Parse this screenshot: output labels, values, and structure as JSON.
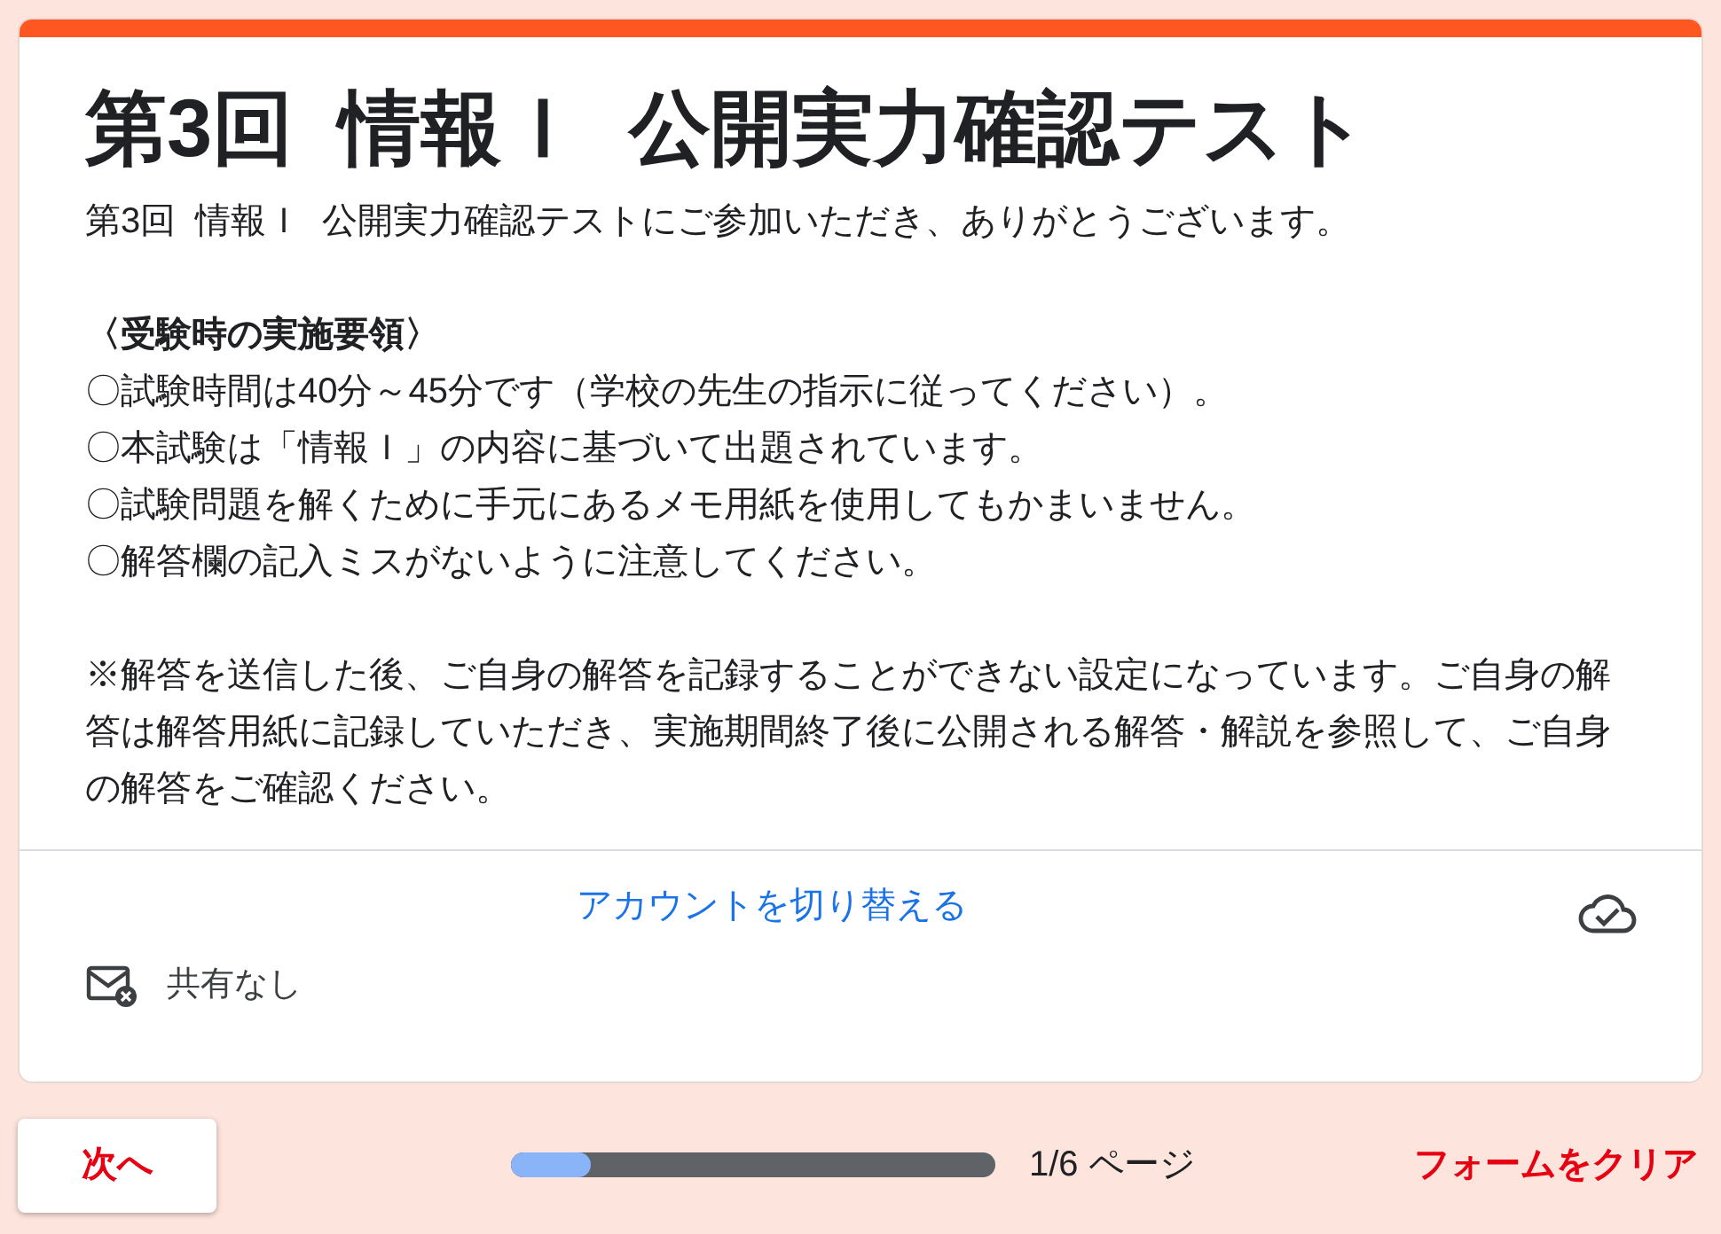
{
  "form": {
    "title": "第3回  情報Ｉ  公開実力確認テスト",
    "intro": "第3回  情報Ｉ  公開実力確認テストにご参加いただき、ありがとうございます。",
    "guidelines": {
      "heading": "〈受験時の実施要領〉",
      "items": [
        "〇試験時間は40分～45分です（学校の先生の指示に従ってください）。",
        "〇本試験は「情報Ｉ」の内容に基づいて出題されています。",
        "〇試験問題を解くために手元にあるメモ用紙を使用してもかまいません。",
        "〇解答欄の記入ミスがないように注意してください。"
      ]
    },
    "note": "※解答を送信した後、ご自身の解答を記録することができない設定になっています。ご自身の解答は解答用紙に記録していただき、実施期間終了後に公開される解答・解説を参照して、ご自身の解答をご確認ください。",
    "switch_account_link": "アカウントを切り替える",
    "sharing_status": "共有なし"
  },
  "footer": {
    "next_button": "次へ",
    "progress": {
      "level": 0.165,
      "label": "1/6 ページ"
    },
    "clear_button": "フォームをクリア"
  }
}
